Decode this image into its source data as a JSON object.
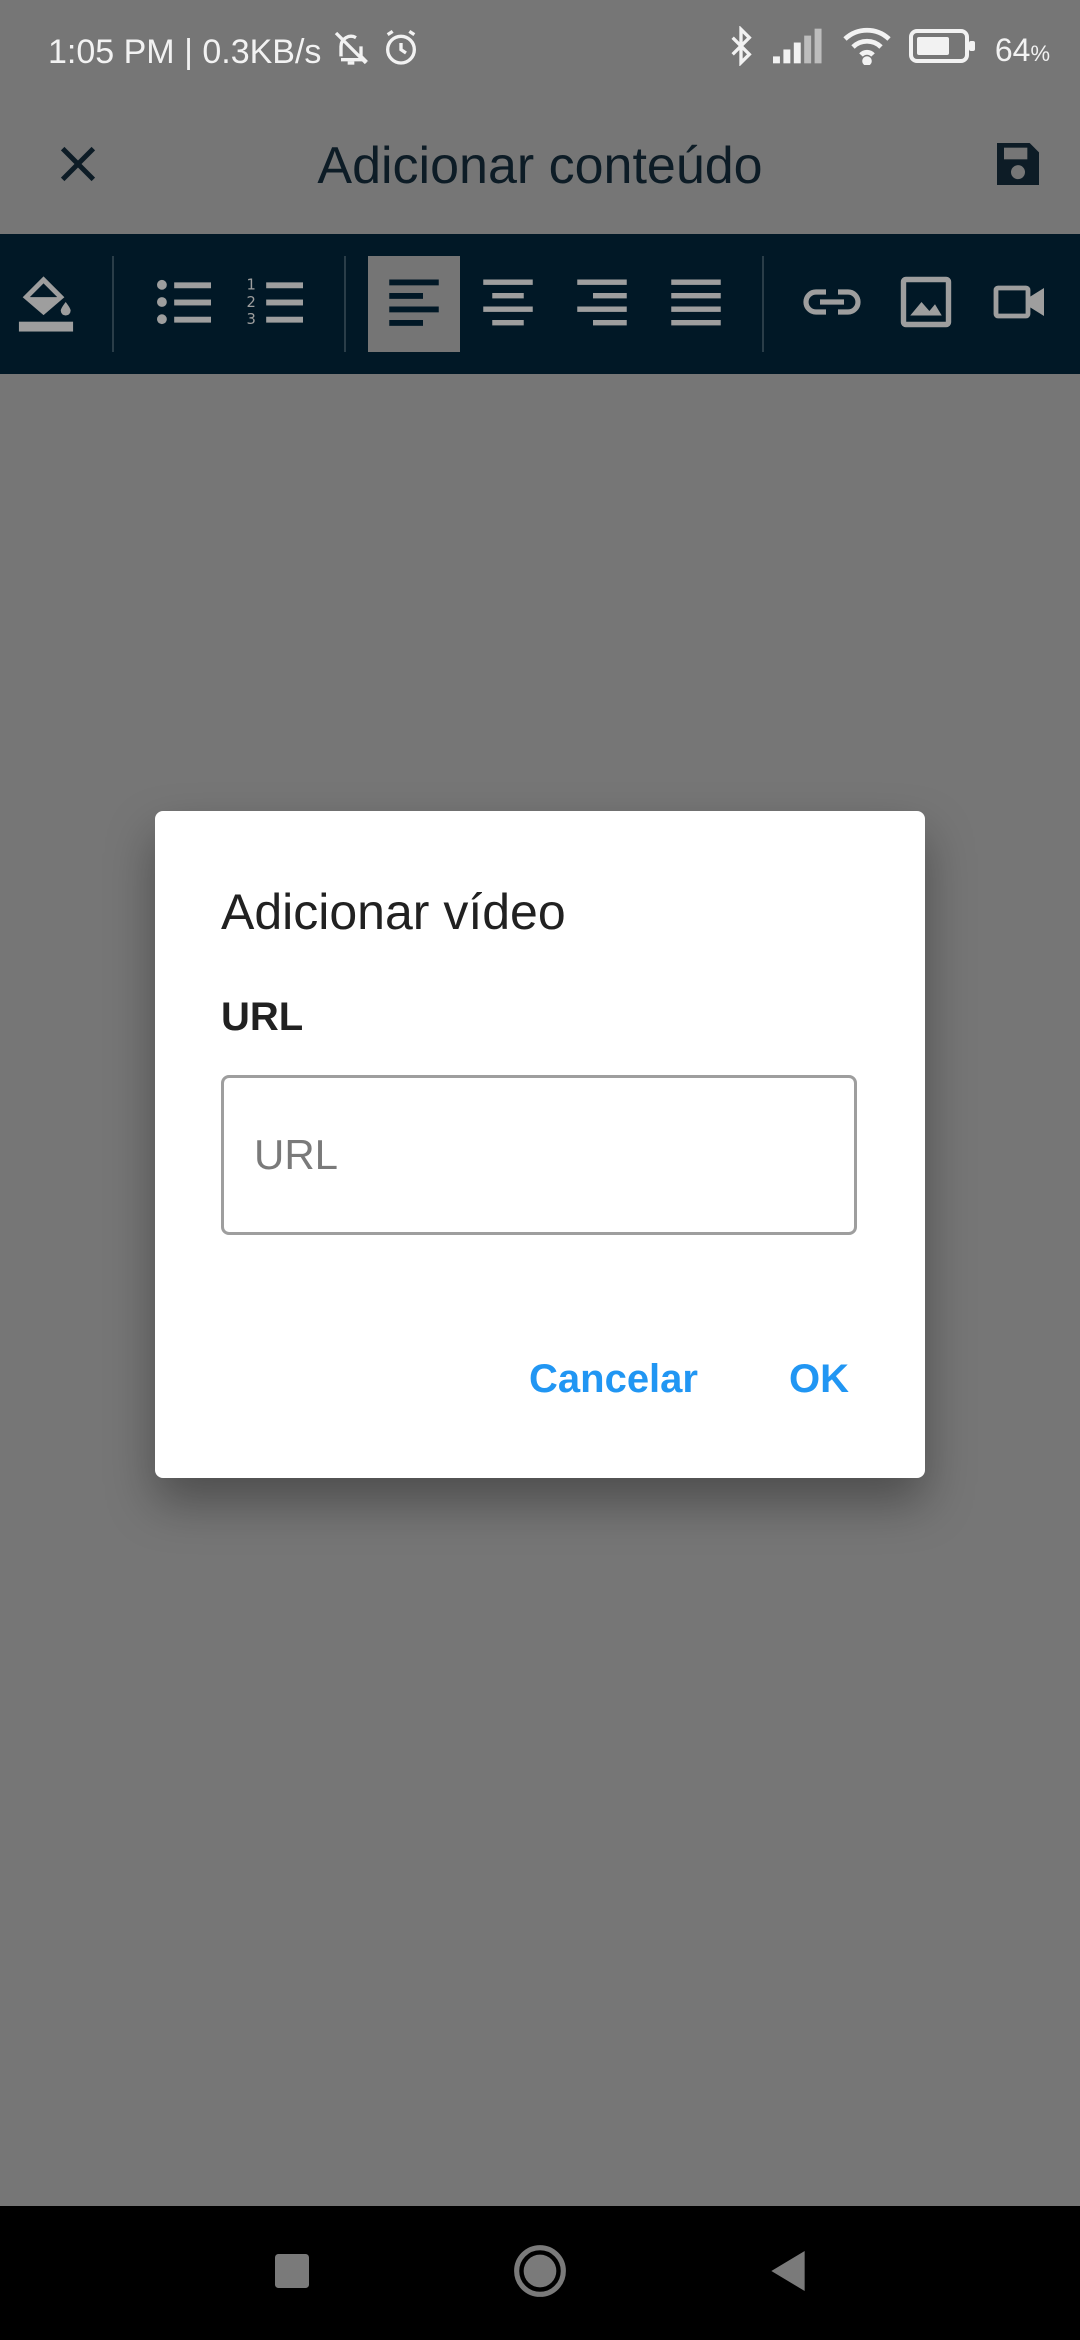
{
  "status_bar": {
    "time": "1:05 PM | 0.3KB/s",
    "battery_percent": "64",
    "battery_unit": "%",
    "icons": [
      "mute-icon",
      "alarm-icon",
      "bluetooth-icon",
      "signal-icon",
      "wifi-icon",
      "battery-icon"
    ]
  },
  "app_bar": {
    "title": "Adicionar conteúdo",
    "icons": [
      "close-icon",
      "save-icon"
    ]
  },
  "toolbar": {
    "buttons": [
      {
        "name": "text-color",
        "icon": "format-color-fill-icon",
        "active": false
      },
      {
        "name": "bullet-list",
        "icon": "bullet-list-icon",
        "active": false
      },
      {
        "name": "numbered-list",
        "icon": "numbered-list-icon",
        "active": false
      },
      {
        "name": "align-left",
        "icon": "align-left-icon",
        "active": true
      },
      {
        "name": "align-center",
        "icon": "align-center-icon",
        "active": false
      },
      {
        "name": "align-right",
        "icon": "align-right-icon",
        "active": false
      },
      {
        "name": "align-justify",
        "icon": "align-justify-icon",
        "active": false
      },
      {
        "name": "insert-link",
        "icon": "link-icon",
        "active": false
      },
      {
        "name": "insert-image",
        "icon": "image-icon",
        "active": false
      },
      {
        "name": "insert-video",
        "icon": "video-icon",
        "active": false
      }
    ]
  },
  "dialog": {
    "title": "Adicionar vídeo",
    "field_label": "URL",
    "input_value": "",
    "input_placeholder": "URL",
    "cancel_label": "Cancelar",
    "ok_label": "OK"
  },
  "nav_bar": {
    "icons": [
      "recents-icon",
      "home-icon",
      "back-icon"
    ]
  },
  "colors": {
    "overlay": "#767676",
    "toolbar": "#011826",
    "accent": "#2196f3",
    "dialog": "#ffffff"
  }
}
